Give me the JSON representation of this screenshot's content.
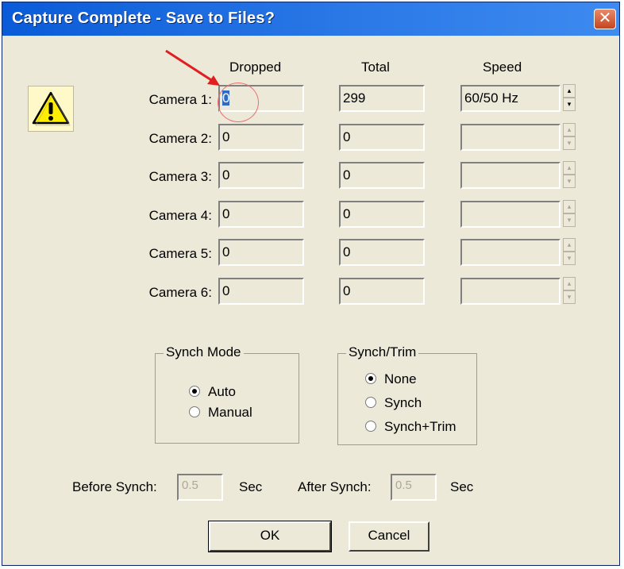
{
  "window": {
    "title": "Capture Complete - Save to Files?",
    "close_symbol": "✕"
  },
  "columns": {
    "dropped": "Dropped",
    "total": "Total",
    "speed": "Speed"
  },
  "cameras": [
    {
      "label": "Camera 1:",
      "dropped": "0",
      "total": "299",
      "speed": "60/50 Hz",
      "speed_enabled": true
    },
    {
      "label": "Camera 2:",
      "dropped": "0",
      "total": "0",
      "speed": "",
      "speed_enabled": false
    },
    {
      "label": "Camera 3:",
      "dropped": "0",
      "total": "0",
      "speed": "",
      "speed_enabled": false
    },
    {
      "label": "Camera 4:",
      "dropped": "0",
      "total": "0",
      "speed": "",
      "speed_enabled": false
    },
    {
      "label": "Camera 5:",
      "dropped": "0",
      "total": "0",
      "speed": "",
      "speed_enabled": false
    },
    {
      "label": "Camera 6:",
      "dropped": "0",
      "total": "0",
      "speed": "",
      "speed_enabled": false
    }
  ],
  "synch_mode": {
    "title": "Synch Mode",
    "options": [
      {
        "label": "Auto",
        "checked": true
      },
      {
        "label": "Manual",
        "checked": false
      }
    ]
  },
  "synch_trim": {
    "title": "Synch/Trim",
    "options": [
      {
        "label": "None",
        "checked": true
      },
      {
        "label": "Synch",
        "checked": false
      },
      {
        "label": "Synch+Trim",
        "checked": false
      }
    ]
  },
  "timing": {
    "before_label": "Before Synch:",
    "before_value": "0.5",
    "before_unit": "Sec",
    "after_label": "After Synch:",
    "after_value": "0.5",
    "after_unit": "Sec"
  },
  "buttons": {
    "ok": "OK",
    "cancel": "Cancel"
  },
  "icons": {
    "warning": "warning-icon",
    "close": "close-icon",
    "spin_up": "spin-up-icon",
    "spin_down": "spin-down-icon"
  },
  "colors": {
    "title_bar": "#0a5bd8",
    "dialog_bg": "#ece9d8",
    "selection": "#316ac5",
    "annotation": "#e02020"
  }
}
